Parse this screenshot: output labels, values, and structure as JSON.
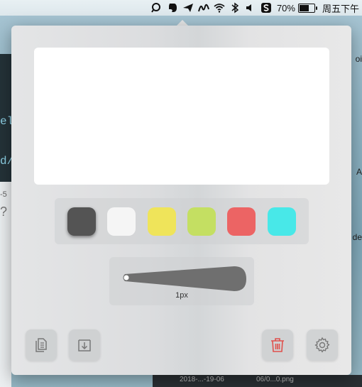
{
  "menubar": {
    "battery_percent": "70%",
    "battery_level": 0.7,
    "clock": "周五下午"
  },
  "background": {
    "left_code_1": "el",
    "left_code_2": "d/",
    "left_small": "-5",
    "left_question": "?",
    "right_frag_1": "oi",
    "right_frag_2": "A",
    "right_frag_3": "de",
    "bottom_file_1": "2018-...-19-06",
    "bottom_file_2": "06/0...0.png"
  },
  "palette": {
    "colors": [
      "#545454",
      "#f5f5f5",
      "#efe45a",
      "#c4df62",
      "#ec6464",
      "#48e8e8"
    ],
    "selected_index": 0
  },
  "stroke": {
    "label": "1px",
    "color": "#6f6f6f"
  },
  "toolbar": {
    "icons": [
      "copy-icon",
      "save-icon",
      "trash-icon",
      "gear-icon"
    ],
    "trash_color": "#e0504c"
  }
}
